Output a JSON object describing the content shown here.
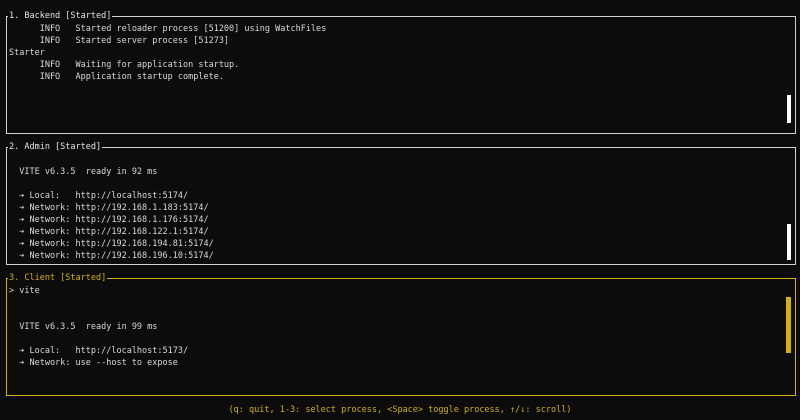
{
  "panels": [
    {
      "title": "1. Backend [Started]",
      "lines": [
        "      INFO   Started reloader process [51200] using WatchFiles",
        "      INFO   Started server process [51273]",
        "Starter",
        "      INFO   Waiting for application startup.",
        "      INFO   Application startup complete.",
        "",
        "",
        "",
        ""
      ]
    },
    {
      "title": "2. Admin [Started]",
      "lines": [
        "",
        "  VITE v6.3.5  ready in 92 ms",
        "",
        "  ➔ Local:   http://localhost:5174/",
        "  ➔ Network: http://192.168.1.183:5174/",
        "  ➔ Network: http://192.168.1.176:5174/",
        "  ➔ Network: http://192.168.122.1:5174/",
        "  ➔ Network: http://192.168.194.81:5174/",
        "  ➔ Network: http://192.168.196.10:5174/"
      ]
    },
    {
      "title": "3. Client [Started]",
      "lines": [
        "> vite",
        "",
        "",
        "  VITE v6.3.5  ready in 99 ms",
        "",
        "  ➔ Local:   http://localhost:5173/",
        "  ➔ Network: use --host to expose",
        "",
        ""
      ]
    }
  ],
  "footer": "(q: quit, 1-3: select process, <Space> toggle process, ↑/↓: scroll)",
  "colors": {
    "accent": "#d4b106",
    "border": "#cfcfcf",
    "background": "#0c0c0c"
  }
}
